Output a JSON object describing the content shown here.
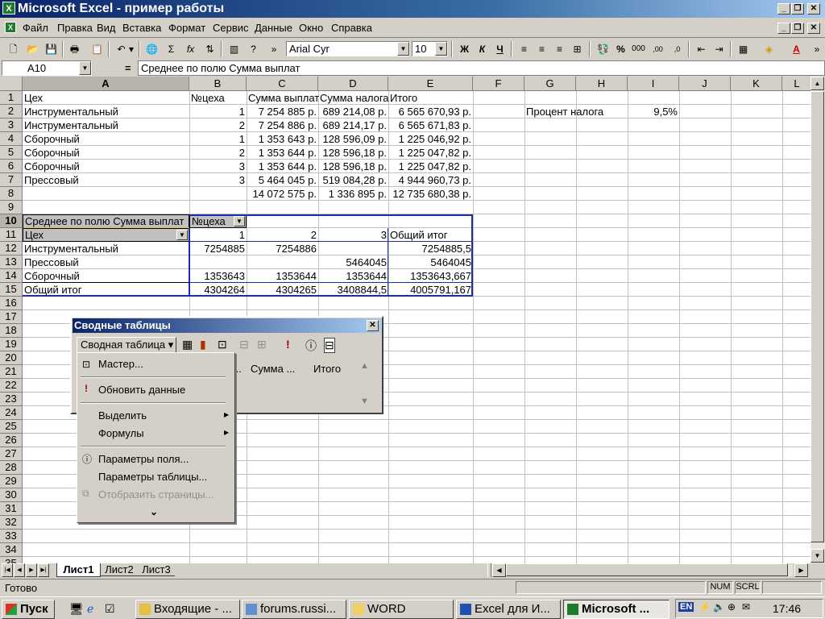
{
  "window": {
    "title": "Microsoft Excel - пример работы",
    "controls": [
      "_",
      "🗗",
      "✕"
    ]
  },
  "menu": [
    "Файл",
    "Правка",
    "Вид",
    "Вставка",
    "Формат",
    "Сервис",
    "Данные",
    "Окно",
    "Справка"
  ],
  "toolbar": {
    "font": "Arial Cyr",
    "size": "10",
    "bold": "Ж",
    "italic": "К",
    "underline": "Ч",
    "percent": "%",
    "thousands": "000",
    "sigma": "Σ",
    "fx": "fx"
  },
  "formula": {
    "namebox": "A10",
    "eq": "=",
    "content": "Среднее по полю Сумма выплат"
  },
  "columns": [
    "A",
    "B",
    "C",
    "D",
    "E",
    "F",
    "G",
    "H",
    "I",
    "J",
    "K",
    "L"
  ],
  "rows": [
    "1",
    "2",
    "3",
    "4",
    "5",
    "6",
    "7",
    "8",
    "9",
    "10",
    "11",
    "12",
    "13",
    "14",
    "15",
    "16",
    "17",
    "18",
    "19",
    "20",
    "21",
    "22",
    "23",
    "24",
    "25",
    "26",
    "27",
    "28",
    "29",
    "30",
    "31",
    "32",
    "33",
    "34",
    "35"
  ],
  "data": {
    "headers": [
      "Цех",
      "№цеха",
      "Сумма выплат",
      "Сумма налога",
      "Итого"
    ],
    "rows": [
      [
        "Инструментальный",
        "1",
        "7 254 885 р.",
        "689 214,08 р.",
        "6 565 670,93 р."
      ],
      [
        "Инструментальный",
        "2",
        "7 254 886 р.",
        "689 214,17 р.",
        "6 565 671,83 р."
      ],
      [
        "Сборочный",
        "1",
        "1 353 643 р.",
        "128 596,09 р.",
        "1 225 046,92 р."
      ],
      [
        "Сборочный",
        "2",
        "1 353 644 р.",
        "128 596,18 р.",
        "1 225 047,82 р."
      ],
      [
        "Сборочный",
        "3",
        "1 353 644 р.",
        "128 596,18 р.",
        "1 225 047,82 р."
      ],
      [
        "Прессовый",
        "3",
        "5 464 045 р.",
        "519 084,28 р.",
        "4 944 960,73 р."
      ]
    ],
    "totals": [
      "",
      "",
      "14 072 575 р.",
      "1 336 895 р.",
      "12 735 680,38 р."
    ],
    "tax_label": "Процент налога",
    "tax_value": "9,5%"
  },
  "pivot": {
    "title": "Среднее по полю Сумма выплат",
    "col_field": "№цеха",
    "row_field": "Цех",
    "col_headers": [
      "1",
      "2",
      "3",
      "Общий итог"
    ],
    "rows": [
      [
        "Инструментальный",
        "7254885",
        "7254886",
        "",
        "7254885,5"
      ],
      [
        "Прессовый",
        "",
        "",
        "5464045",
        "5464045"
      ],
      [
        "Сборочный",
        "1353643",
        "1353644",
        "1353644",
        "1353643,667"
      ],
      [
        "Общий итог",
        "4304264",
        "4304265",
        "3408844,5",
        "4005791,167"
      ]
    ]
  },
  "pivot_toolbar": {
    "title": "Сводные таблицы",
    "dropdown": "Сводная таблица ▾",
    "field1": "...",
    "field2": "Сумма ...",
    "field3": "Итого"
  },
  "pivot_menu": {
    "master": "Мастер...",
    "refresh": "Обновить данные",
    "select": "Выделить",
    "formulas": "Формулы",
    "field_params": "Параметры поля...",
    "table_params": "Параметры таблицы...",
    "show_pages": "Отобразить страницы..."
  },
  "sheets": [
    "Лист1",
    "Лист2",
    "Лист3"
  ],
  "status": {
    "ready": "Готово",
    "num": "NUM",
    "scrl": "SCRL"
  },
  "taskbar": {
    "start": "Пуск",
    "tasks": [
      "Входящие - ...",
      "forums.russi...",
      "WORD",
      "Excel для И...",
      "Microsoft ..."
    ],
    "lang": "EN",
    "time": "17:46"
  }
}
